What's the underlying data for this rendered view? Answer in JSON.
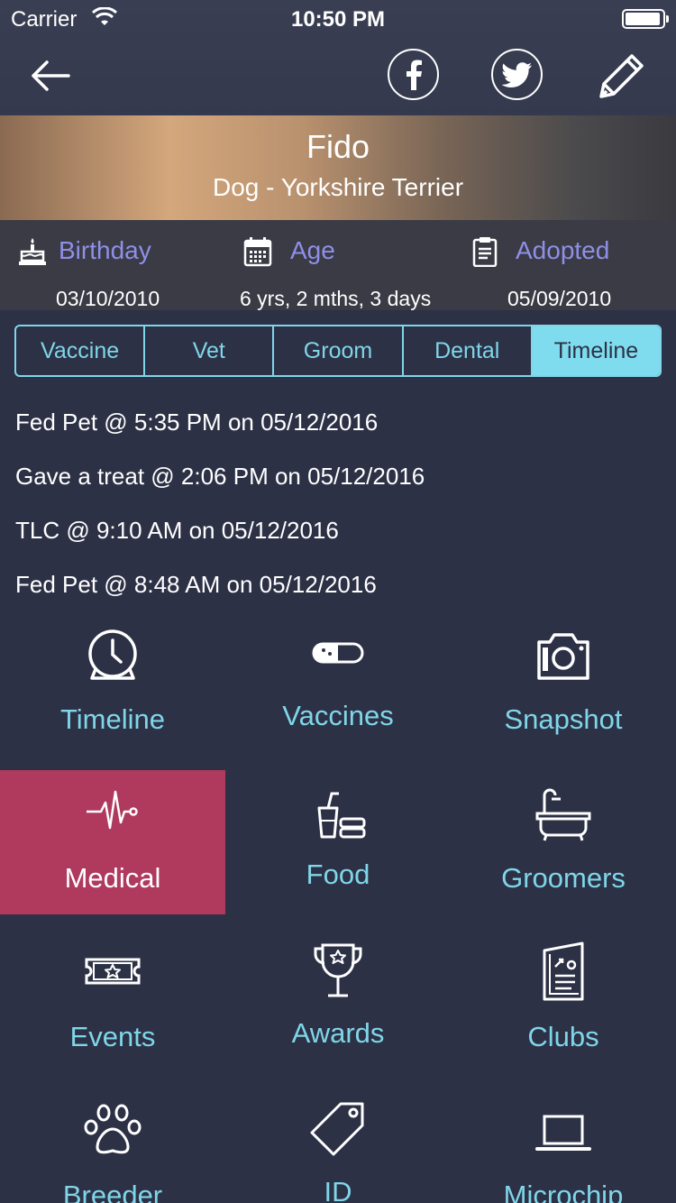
{
  "status_bar": {
    "carrier": "Carrier",
    "time": "10:50 PM"
  },
  "nav": {
    "icons": [
      "back-arrow-icon",
      "facebook-icon",
      "twitter-icon",
      "pencil-icon"
    ]
  },
  "pet": {
    "name": "Fido",
    "breed": "Dog - Yorkshire Terrier"
  },
  "info": {
    "birthday": {
      "label": "Birthday",
      "value": "03/10/2010",
      "icon": "cake-icon"
    },
    "age": {
      "label": "Age",
      "value": "6 yrs, 2 mths, 3 days",
      "icon": "calendar-icon"
    },
    "adopted": {
      "label": "Adopted",
      "value": "05/09/2010",
      "icon": "clipboard-icon"
    }
  },
  "tabs": [
    {
      "label": "Vaccine"
    },
    {
      "label": "Vet"
    },
    {
      "label": "Groom"
    },
    {
      "label": "Dental"
    },
    {
      "label": "Timeline",
      "active": true
    }
  ],
  "events": [
    "Fed Pet @ 5:35 PM on 05/12/2016",
    "Gave a treat @ 2:06 PM on 05/12/2016",
    "TLC @ 9:10 AM on 05/12/2016",
    "Fed Pet @ 8:48 AM on 05/12/2016"
  ],
  "menu": [
    {
      "label": "Timeline",
      "icon": "clock-icon"
    },
    {
      "label": "Vaccines",
      "icon": "pill-icon"
    },
    {
      "label": "Snapshot",
      "icon": "camera-icon"
    },
    {
      "label": "Medical",
      "icon": "heartbeat-icon",
      "active": true
    },
    {
      "label": "Food",
      "icon": "food-icon"
    },
    {
      "label": "Groomers",
      "icon": "bathtub-icon"
    },
    {
      "label": "Events",
      "icon": "ticket-icon"
    },
    {
      "label": "Awards",
      "icon": "trophy-icon"
    },
    {
      "label": "Clubs",
      "icon": "newspaper-icon"
    },
    {
      "label": "Breeder",
      "icon": "paw-icon"
    },
    {
      "label": "ID",
      "icon": "tag-icon"
    },
    {
      "label": "Microchip",
      "icon": "laptop-icon"
    }
  ],
  "colors": {
    "background": "#2d3146",
    "accent": "#7fd6e8",
    "active_tile": "#b03a5e",
    "info_label": "#8f8fe8"
  }
}
